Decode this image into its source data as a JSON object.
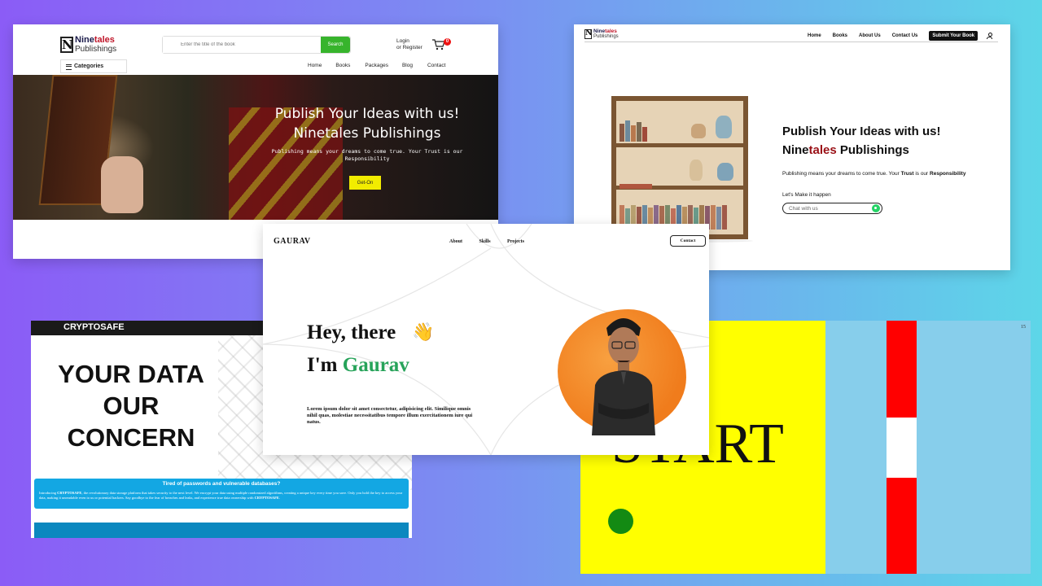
{
  "ninetales_hero": {
    "logo": {
      "mark": "N",
      "nine": "Nine",
      "tales": "tales",
      "publishings": "Publishings"
    },
    "search": {
      "placeholder": "Enter the title of the book",
      "button": "Search"
    },
    "login": {
      "line1": "Login",
      "line2": "or Register"
    },
    "cart_count": "0",
    "categories": "Categories",
    "nav": [
      "Home",
      "Books",
      "Packages",
      "Blog",
      "Contact"
    ],
    "hero_title_1": "Publish Your Ideas with us!",
    "hero_title_2": "Ninetales Publishings",
    "hero_sub_1": "Publishing means your dreams to come true. Your Trust is our",
    "hero_sub_2": "Responsibility",
    "hero_button": "Get-On"
  },
  "ninetales_shelf": {
    "logo": {
      "mark": "N",
      "nine": "Nine",
      "tales": "tales",
      "publishings": "Publishings"
    },
    "nav": [
      "Home",
      "Books",
      "About Us",
      "Contact Us"
    ],
    "cta": "Submit Your Book",
    "title_1": "Publish Your Ideas with us!",
    "title_nine": "Nine",
    "title_tales": "tales",
    "title_pub": " Publishings",
    "desc_pre": "Publishing means your dreams to come true. Your ",
    "desc_trust": "Trust",
    "desc_mid": " is our ",
    "desc_resp": "Responsibility",
    "lets": "Let's Make it happen",
    "chat_placeholder": "Chat with us",
    "colors": {
      "accent_red": "#9a1016",
      "whatsapp": "#25d366"
    }
  },
  "cryptosafe": {
    "brand": "CRYPTOSAFE",
    "headline": [
      "YOUR DATA",
      "OUR",
      "CONCERN"
    ],
    "band_title": "Tired of passwords and vulnerable databases?",
    "band_text_1": "Introducing ",
    "band_brand": "CRYPTOSAFE",
    "band_text_2": ", the revolutionary data storage platform that takes security to the next level. We encrypt your data using multiple randomized algorithms, creating a unique key every time you save. Only you hold the key to access your data, making it unreadable even to us or potential hackers. Say goodbye to the fear of breaches and leaks, and experience true data ownership with ",
    "band_brand_2": "CRYPTOSAFE",
    "band_end": ".",
    "colors": {
      "band": "#13a7e3",
      "footer": "#0b88bf"
    }
  },
  "game": {
    "start_text": "START",
    "score": "15",
    "colors": {
      "yellow": "#ffff00",
      "sky": "#87ceeb",
      "red": "#ff0000",
      "dot": "#138a13"
    }
  },
  "portfolio": {
    "brand": "GAURAV",
    "nav": [
      "About",
      "Skills",
      "Projects"
    ],
    "contact": "Contact",
    "hey": "Hey, there",
    "wave_icon": "👋",
    "im": "I'm ",
    "name": "Gaurav",
    "lorem": "Lorem ipsum dolor sit amet consectetur, adipisicing elit. Similique omnis nihil quas, molestiae necessitatibus tempore illum exercitationem iure qui natus.",
    "colors": {
      "name_green": "#27a35a",
      "blob_orange": "#f07c1c"
    }
  }
}
